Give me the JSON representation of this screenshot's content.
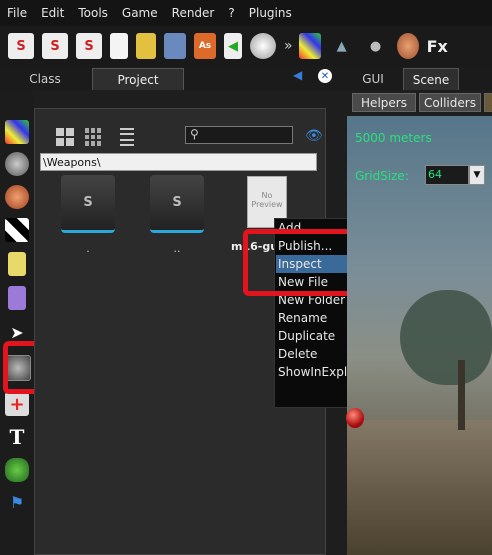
{
  "menubar": {
    "items": [
      "File",
      "Edit",
      "Tools",
      "Game",
      "Render",
      "?",
      "Plugins"
    ]
  },
  "toolbar": {
    "overflow": "»",
    "fx_label": "Fx"
  },
  "left_tabs": {
    "class_label": "Class",
    "project_label": "Project"
  },
  "right_tabs": {
    "gui_label": "GUI",
    "scene_label": "Scene"
  },
  "project": {
    "path": "\\Weapons\\",
    "items": [
      {
        "label": "."
      },
      {
        "label": ".."
      },
      {
        "label": "m16-gu"
      }
    ],
    "file_thumbnail_text": "No Preview"
  },
  "context_menu": {
    "items": [
      {
        "label": "Add"
      },
      {
        "label": "Publish..."
      },
      {
        "label": "Inspect"
      },
      {
        "label": "New File"
      },
      {
        "label": "New Folder"
      },
      {
        "label": "Rename"
      },
      {
        "label": "Duplicate"
      },
      {
        "label": "Delete"
      },
      {
        "label": "ShowInExplorer"
      }
    ],
    "highlighted": "Inspect"
  },
  "scene": {
    "helpers_label": "Helpers",
    "colliders_label": "Colliders",
    "distance": "5000 meters",
    "gridsize_label": "GridSize:",
    "gridsize_value": "64"
  },
  "colors": {
    "accent_green": "#27e27c",
    "highlight_red": "#e4141e",
    "menu_highlight": "#3a6a9a"
  }
}
